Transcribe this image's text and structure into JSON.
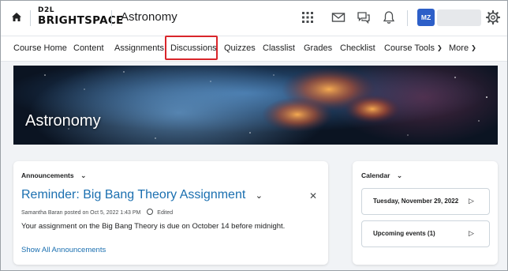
{
  "header": {
    "logo_top": "D2L",
    "logo_main": "BRIGHTSPACE",
    "course_title": "Astronomy",
    "avatar_initials": "MZ",
    "icons": [
      "home-icon",
      "waffle-grid-icon",
      "mail-icon",
      "chat-icon",
      "bell-icon",
      "gear-icon"
    ]
  },
  "nav": {
    "items": [
      {
        "label": "Course Home"
      },
      {
        "label": "Content"
      },
      {
        "label": "Assignments"
      },
      {
        "label": "Discussions"
      },
      {
        "label": "Quizzes"
      },
      {
        "label": "Classlist"
      },
      {
        "label": "Grades"
      },
      {
        "label": "Checklist"
      },
      {
        "label": "Course Tools"
      },
      {
        "label": "More"
      }
    ],
    "highlight_color": "#d9252b"
  },
  "banner": {
    "title": "Astronomy"
  },
  "announcements": {
    "widget_title": "Announcements",
    "item_title": "Reminder: Big Bang Theory Assignment",
    "meta": "Samantha Baran posted on Oct 5, 2022 1:43 PM",
    "edited": "Edited",
    "body": "Your assignment on the Big Bang Theory is due on October 14 before midnight.",
    "show_all": "Show All Announcements"
  },
  "calendar": {
    "widget_title": "Calendar",
    "date_label": "Tuesday, November 29, 2022",
    "upcoming_label": "Upcoming events (1)"
  },
  "colors": {
    "link": "#1a6fb0",
    "avatar": "#2d5fc8",
    "page_bg": "#f1f3f6"
  }
}
